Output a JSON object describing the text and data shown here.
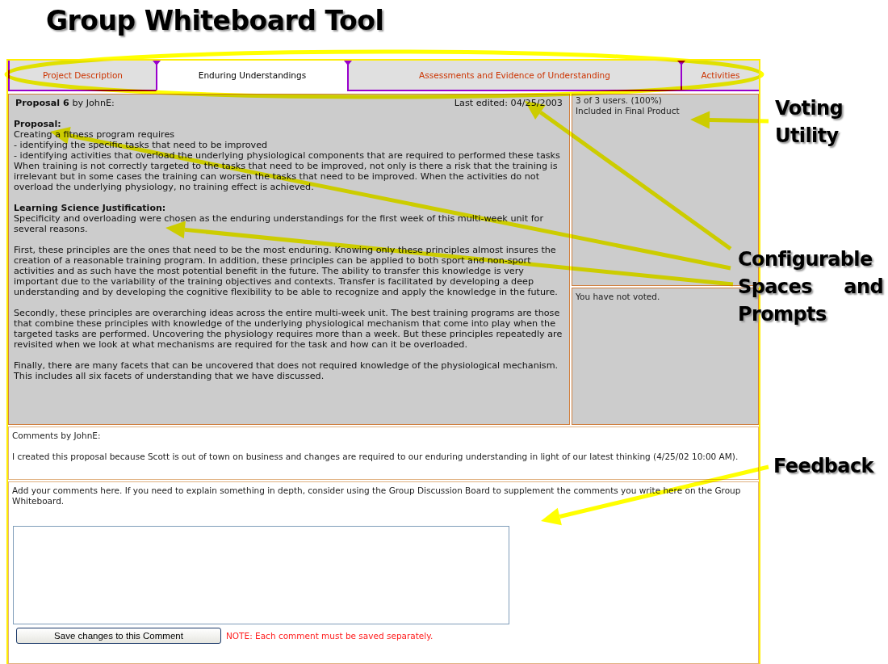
{
  "slide": {
    "title": "Group Whiteboard Tool",
    "callouts": [
      {
        "kind": "voting",
        "label": "Voting Utility"
      },
      {
        "kind": "spaces",
        "label": "Configurable Spaces and Prompts"
      },
      {
        "kind": "feedback",
        "label": "Feedback"
      }
    ]
  },
  "tabs": [
    {
      "label": "Project Description",
      "selected": false
    },
    {
      "label": "Enduring Understandings",
      "selected": true
    },
    {
      "label": "Assessments and Evidence of Understanding",
      "selected": false
    },
    {
      "label": "Activities",
      "selected": false
    }
  ],
  "proposal": {
    "title": "**Proposal 6** by JohnE:",
    "last_edited": "Last edited: 04/25/2003",
    "sections": [
      {
        "heading": "Proposal:",
        "spaced": false,
        "paragraphs": [
          "Creating a fitness program requires",
          "- identifying the specific tasks that need to be improved",
          "- identifying activities that overload the underlying physiological components that are required to performed these tasks",
          "When training is not correctly targeted to the tasks that need to be improved, not only is there a risk that the training is irrelevant but in some cases the training can worsen the tasks that need to be improved. When the activities do not overload the underlying physiology, no training effect is achieved."
        ]
      },
      {
        "heading": "Learning Science Justification:",
        "spaced": true,
        "paragraphs": [
          "Specificity and overloading were chosen as the enduring understandings for the first week of this multi-week unit for several reasons.",
          "First, these principles are the ones that need to be the most enduring. Knowing only these principles almost insures the creation of a reasonable training program. In addition, these principles can be applied to both sport and non-sport activities and as such have the most potential benefit in the future. The ability to transfer this knowledge is very important due to the variability of the training objectives and contexts. Transfer is facilitated by developing a deep understanding and by developing the cognitive flexibility to be able to recognize and apply the knowledge in the future.",
          "Secondly, these principles are overarching ideas across the entire multi-week unit. The best training programs are those that combine these principles with knowledge of the underlying physiological mechanism that come into play when the targeted tasks are performed. Uncovering the physiology requires more than a week. But these principles repeatedly are revisited when we look at what mechanisms are required for the task and how can it be overloaded.",
          "Finally, there are many facets that can be uncovered that does not required knowledge of the physiological mechanism. This includes all six facets of understanding that we have discussed."
        ]
      }
    ]
  },
  "voting": {
    "result": "3 of 3 users. (100%)",
    "status": "Included in Final Product",
    "my_vote": "You have not voted."
  },
  "comments": {
    "header": "Comments by JohnE:",
    "text": "I created this proposal because Scott is out of town on business and changes are required to our enduring understanding in light of our latest thinking (4/25/02 10:00 AM)."
  },
  "feedback": {
    "prompt": "Add your comments here. If you need to explain something in depth, consider using the Group Discussion Board to supplement the comments you write here on the Group Whiteboard.",
    "button": "Save changes to this Comment",
    "note": "NOTE: Each comment must be saved separately."
  }
}
